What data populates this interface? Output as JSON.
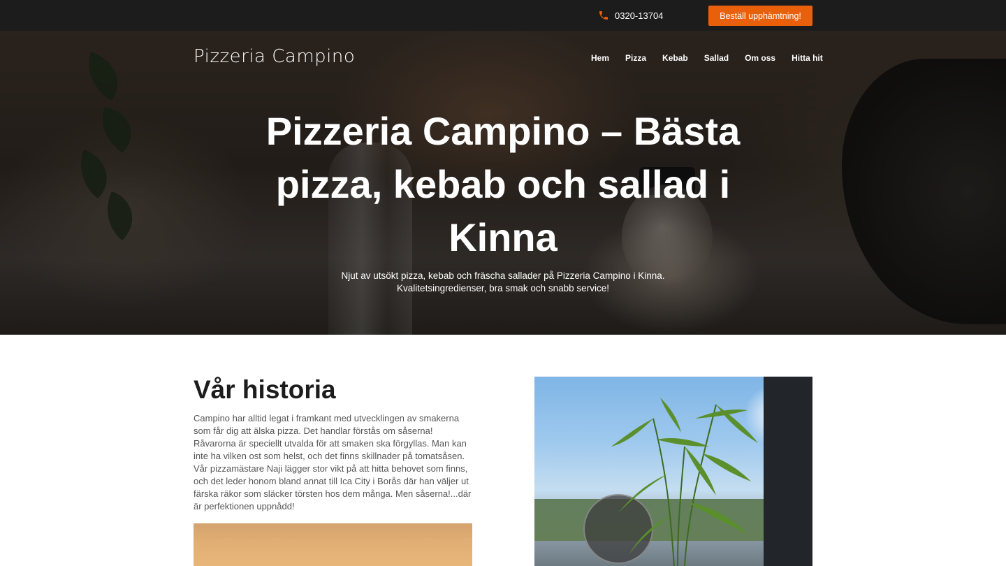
{
  "topbar": {
    "phone_icon": "phone-icon",
    "phone": "0320-13704",
    "order_button": "Beställ upphämtning!",
    "accent_color": "#e8600b"
  },
  "header": {
    "logo": "Pizzeria Campino",
    "nav": [
      {
        "label": "Hem"
      },
      {
        "label": "Pizza"
      },
      {
        "label": "Kebab"
      },
      {
        "label": "Sallad"
      },
      {
        "label": "Om oss"
      },
      {
        "label": "Hitta hit"
      }
    ]
  },
  "hero": {
    "title": "Pizzeria Campino – Bästa pizza, kebab och sallad i Kinna",
    "subtitle_line1": "Njut av utsökt pizza, kebab och fräscha sallader på Pizzeria Campino i Kinna.",
    "subtitle_line2": "Kvalitetsingredienser, bra smak och snabb service!"
  },
  "story": {
    "title": "Vår historia",
    "text": "Campino har alltid legat i framkant med utvecklingen av smakerna som får dig att älska pizza. Det handlar förstås om såserna! Råvarorna är speciellt utvalda för att smaken ska förgyllas. Man kan inte ha vilken ost som helst, och det finns skillnader på tomatsåsen. Vår pizzamästare Naji lägger stor vikt på att hitta behovet som finns, och det leder honom bland annat till Ica City i Borås där han väljer ut färska räkor som släcker törsten hos dem många. Men såserna!...där är perfektionen uppnådd!"
  }
}
